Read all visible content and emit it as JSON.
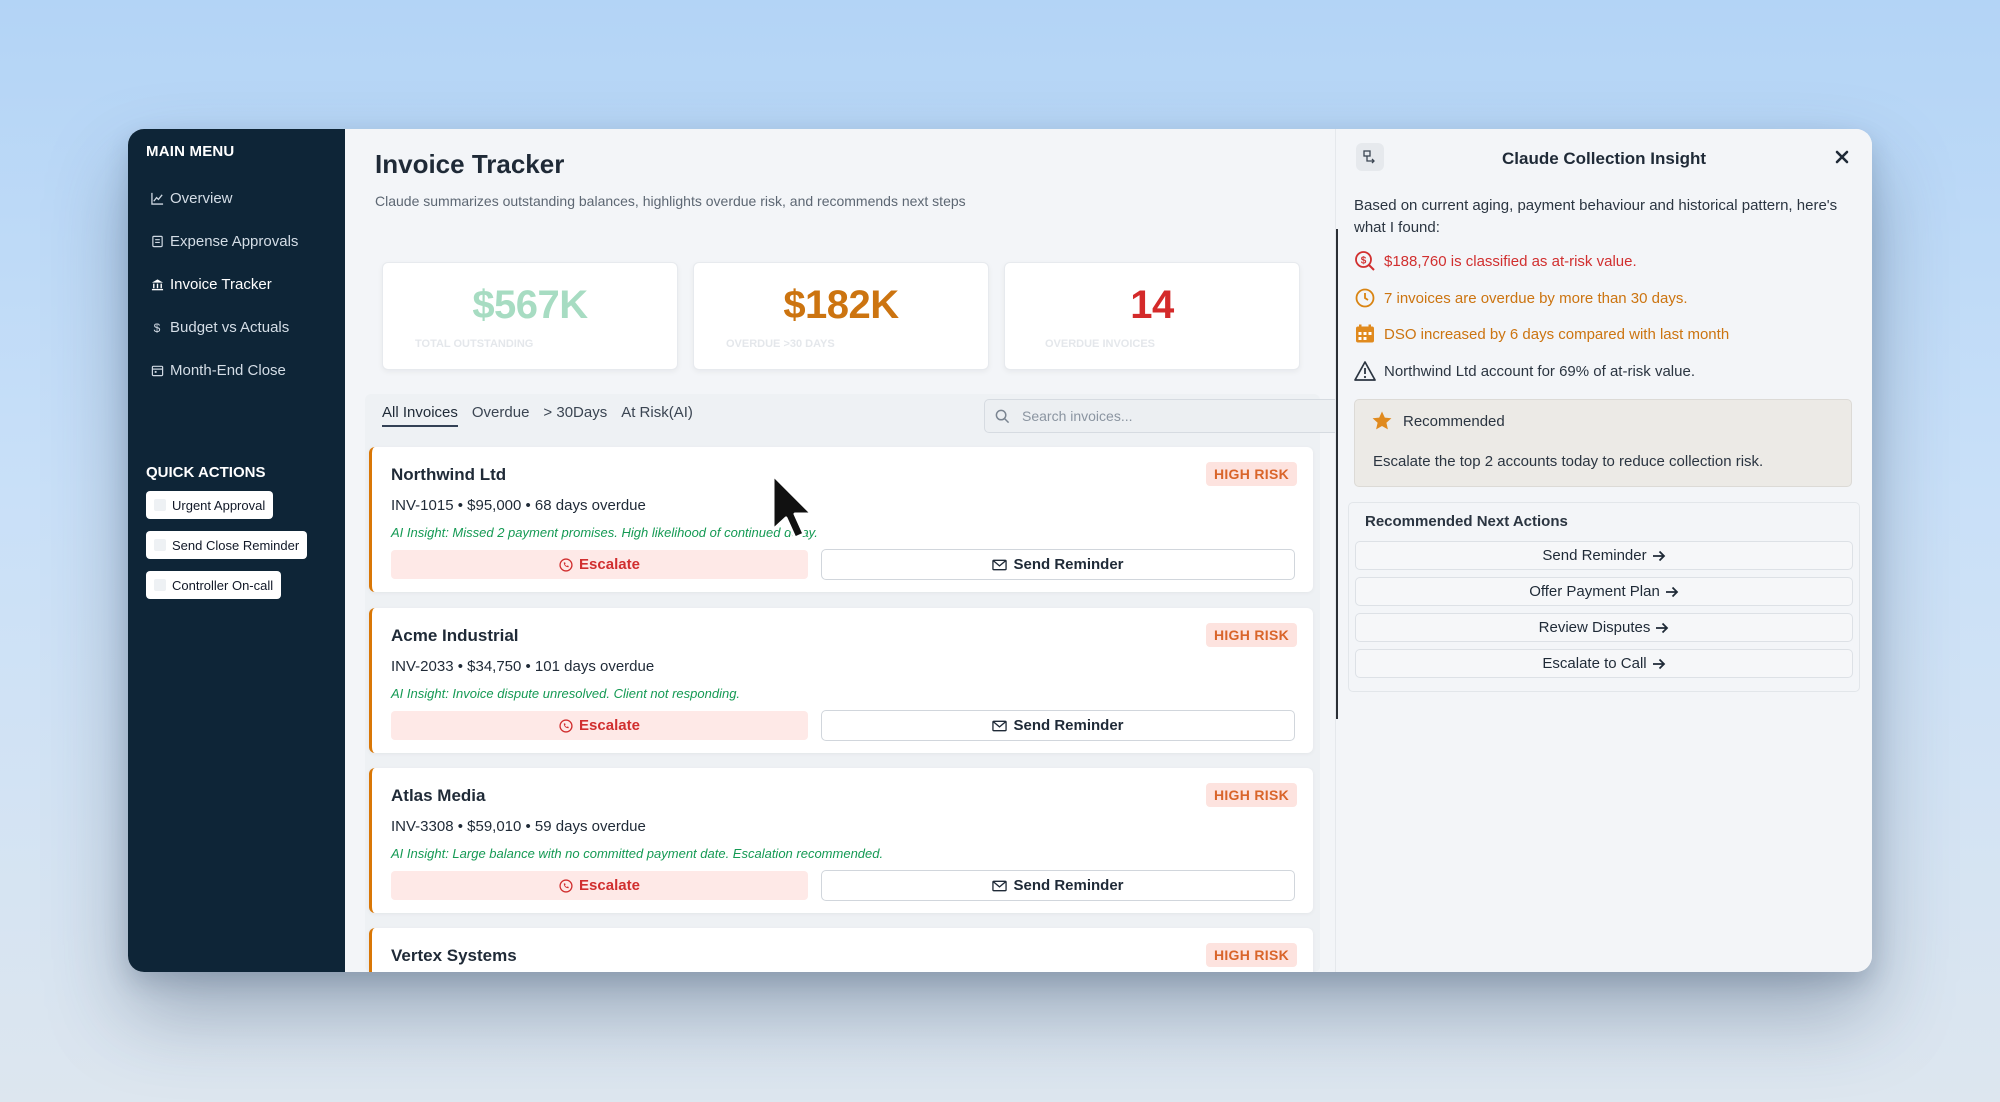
{
  "sidebar": {
    "main_menu_heading": "MAIN MENU",
    "items": [
      {
        "label": "Overview",
        "icon": "chart-line-icon"
      },
      {
        "label": "Expense Approvals",
        "icon": "receipt-icon"
      },
      {
        "label": "Invoice Tracker",
        "icon": "bank-icon",
        "active": true
      },
      {
        "label": "Budget vs Actuals",
        "icon": "dollar-icon"
      },
      {
        "label": "Month-End Close",
        "icon": "calendar-icon"
      }
    ],
    "quick_actions_heading": "QUICK ACTIONS",
    "quick_actions": [
      "Urgent Approval",
      "Send Close Reminder",
      "Controller On-call"
    ]
  },
  "main": {
    "title": "Invoice Tracker",
    "subtitle": "Claude summarizes outstanding balances, highlights overdue risk, and recommends next steps",
    "kpis": [
      {
        "value": "$567K",
        "label": "TOTAL OUTSTANDING",
        "color": "#a7dcc2"
      },
      {
        "value": "$182K",
        "label": "OVERDUE >30 DAYS",
        "color": "#cc7410"
      },
      {
        "value": "14",
        "label": "OVERDUE INVOICES",
        "color": "#d42a2a"
      }
    ],
    "tabs": [
      "All Invoices",
      "Overdue",
      "> 30Days",
      "At Risk(AI)"
    ],
    "search_placeholder": "Search invoices...",
    "invoices": [
      {
        "name": "Northwind Ltd",
        "badge": "HIGH RISK",
        "meta": "INV-1015 • $95,000 • 68 days overdue",
        "insight": "AI Insight: Missed 2 payment promises. High likelihood of continued delay.",
        "escalate_label": "Escalate",
        "reminder_label": "Send Reminder"
      },
      {
        "name": "Acme Industrial",
        "badge": "HIGH RISK",
        "meta": "INV-2033 • $34,750 • 101 days overdue",
        "insight": "AI Insight: Invoice dispute unresolved. Client not responding.",
        "escalate_label": "Escalate",
        "reminder_label": "Send Reminder"
      },
      {
        "name": "Atlas Media",
        "badge": "HIGH RISK",
        "meta": "INV-3308 • $59,010 • 59 days overdue",
        "insight": "AI Insight: Large balance with no committed payment date. Escalation recommended.",
        "escalate_label": "Escalate",
        "reminder_label": "Send Reminder"
      },
      {
        "name": "Vertex Systems",
        "badge": "HIGH RISK"
      }
    ]
  },
  "insight_panel": {
    "title": "Claude Collection Insight",
    "intro": "Based on current aging, payment behaviour and historical pattern, here's what I found:",
    "findings": [
      {
        "text": "$188,760 is classified as at-risk value.",
        "color": "#d12f2f",
        "icon": "dollar-search-icon"
      },
      {
        "text": "7 invoices are overdue by more than 30 days.",
        "color": "#cc7410",
        "icon": "clock-icon"
      },
      {
        "text": "DSO increased by 6 days compared with last month",
        "color": "#cc7410",
        "icon": "calendar-icon"
      },
      {
        "text": "Northwind Ltd account for 69% of at-risk value.",
        "color": "#2b3541",
        "icon": "warning-icon"
      }
    ],
    "recommended_title": "Recommended",
    "recommended_text": "Escalate the top 2 accounts today to reduce collection risk.",
    "next_actions_title": "Recommended Next Actions",
    "next_actions": [
      "Send Reminder",
      "Offer Payment Plan",
      "Review Disputes",
      "Escalate to Call"
    ]
  }
}
